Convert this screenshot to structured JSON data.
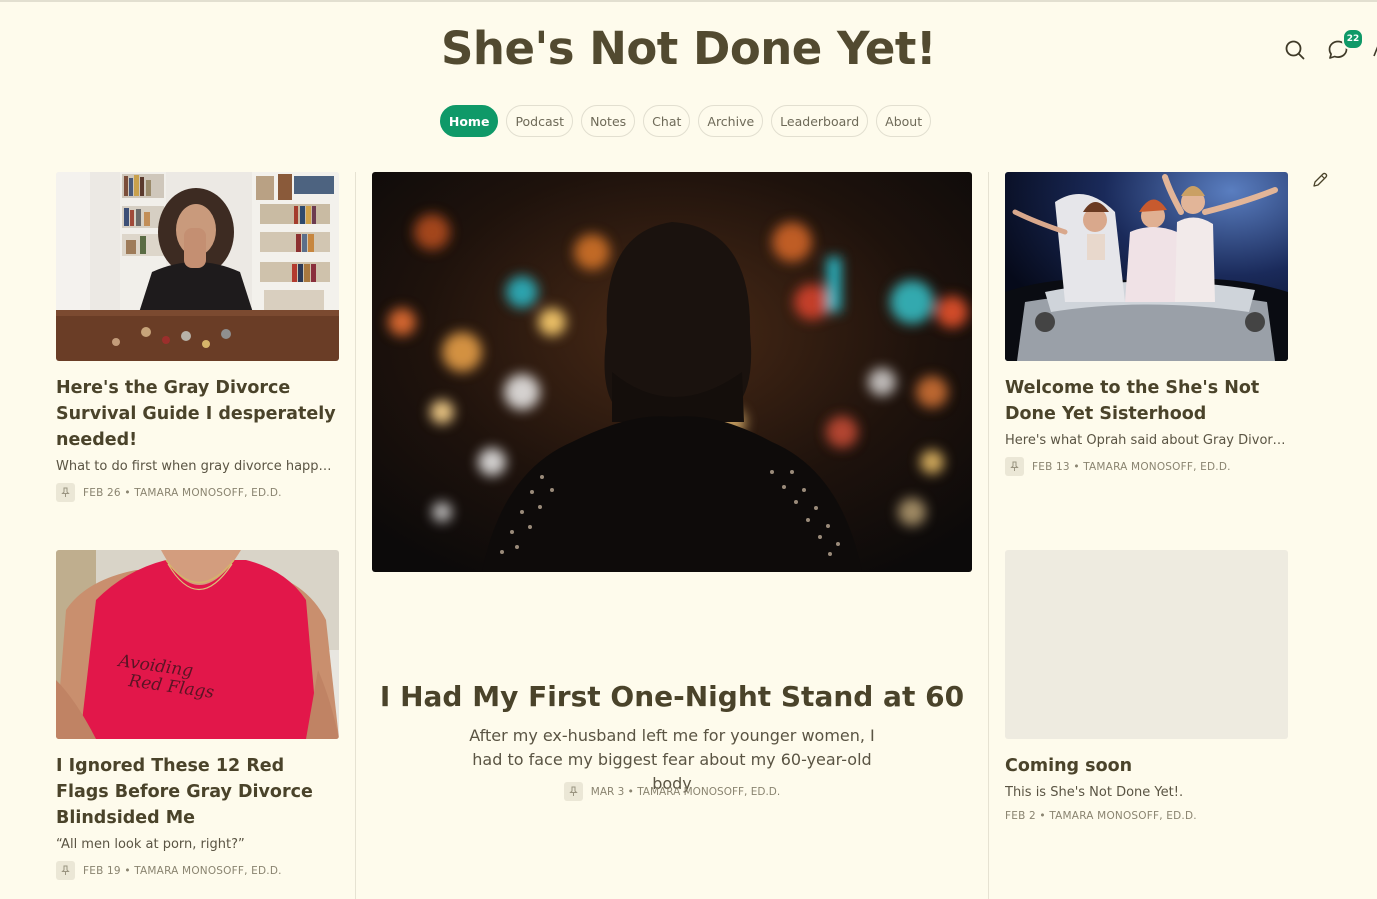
{
  "site": {
    "title": "She's Not Done Yet!"
  },
  "header": {
    "notification_count": "22",
    "search_icon": "search-icon",
    "chat_icon": "chat-bubble-icon"
  },
  "nav": {
    "tabs": [
      {
        "label": "Home",
        "active": true
      },
      {
        "label": "Podcast"
      },
      {
        "label": "Notes"
      },
      {
        "label": "Chat"
      },
      {
        "label": "Archive"
      },
      {
        "label": "Leaderboard"
      },
      {
        "label": "About"
      }
    ]
  },
  "posts": {
    "left_top": {
      "title": "Here's the Gray Divorce Survival Guide I desperately needed!",
      "subtitle": "What to do first when gray divorce happens",
      "meta": "FEB 26 • TAMARA MONOSOFF, ED.D."
    },
    "left_bottom": {
      "title": "I Ignored These 12 Red Flags Before Gray Divorce Blindsided Me",
      "subtitle": "“All men look at porn, right?”",
      "meta": "FEB 19 • TAMARA MONOSOFF, ED.D.",
      "shirt_text_1": "Avoiding",
      "shirt_text_2": "Red Flags"
    },
    "featured": {
      "title": "I Had My First One-Night Stand at 60",
      "subtitle": "After my ex-husband left me for younger women, I had to face my biggest fear about my 60-year-old body",
      "meta": "MAR 3 • TAMARA MONOSOFF, ED.D."
    },
    "right_top": {
      "title": "Welcome to the She's Not Done Yet Sisterhood",
      "subtitle": "Here's what Oprah said about Gray Divorce...",
      "meta": "FEB 13 • TAMARA MONOSOFF, ED.D."
    },
    "right_bottom": {
      "title": "Coming soon",
      "subtitle": "This is She's Not Done Yet!.",
      "meta": "FEB 2 • TAMARA MONOSOFF, ED.D."
    }
  },
  "colors": {
    "accent": "#0f9968",
    "background": "#fefbec",
    "text": "#4a432a"
  }
}
